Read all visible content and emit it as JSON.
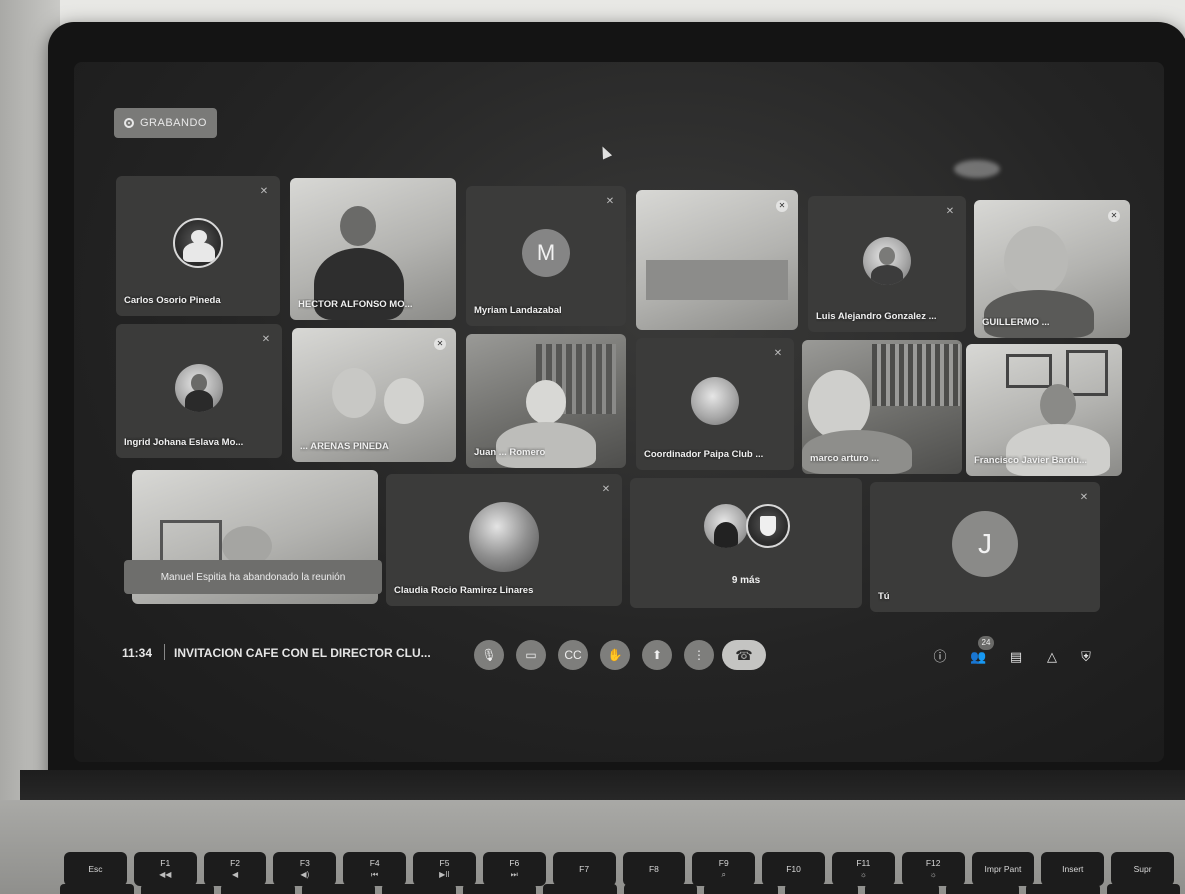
{
  "recording": {
    "label": "GRABANDO"
  },
  "meeting": {
    "time": "11:34",
    "title": "INVITACION CAFE CON EL DIRECTOR CLU...",
    "participant_count": "24"
  },
  "tiles": [
    {
      "name": "Carlos Osorio Pineda"
    },
    {
      "name": "HECTOR ALFONSO MO..."
    },
    {
      "name": "Myriam Landazabal",
      "avatar_letter": "M"
    },
    {
      "name": ""
    },
    {
      "name": "Luis Alejandro Gonzalez ..."
    },
    {
      "name": "GUILLERMO ..."
    },
    {
      "name": "Ingrid Johana Eslava Mo..."
    },
    {
      "name": "... ARENAS PINEDA"
    },
    {
      "name": "Juan ... Romero"
    },
    {
      "name": "Coordinador Paipa Club ..."
    },
    {
      "name": "marco arturo ..."
    },
    {
      "name": "Francisco Javier Bardu..."
    },
    {
      "name": ""
    },
    {
      "name": "Claudia Rocio Ramirez Linares"
    },
    {
      "name": "9 más"
    },
    {
      "name": "Tú",
      "avatar_letter": "J"
    }
  ],
  "notification": "Manuel Espitia ha abandonado la reunión",
  "controls": {
    "icons": [
      "mic-off-icon",
      "camera-off-icon",
      "captions-icon",
      "raise-hand-icon",
      "present-icon",
      "more-options-icon",
      "end-call-icon"
    ],
    "right_icons": [
      "info-icon",
      "people-icon",
      "chat-icon",
      "activities-icon",
      "host-controls-icon"
    ]
  },
  "keyboard": {
    "keys": [
      {
        "label": "Esc",
        "sub": ""
      },
      {
        "label": "F1",
        "sub": "◀◀"
      },
      {
        "label": "F2",
        "sub": "◀"
      },
      {
        "label": "F3",
        "sub": "◀)"
      },
      {
        "label": "F4",
        "sub": "⏮"
      },
      {
        "label": "F5",
        "sub": "▶II"
      },
      {
        "label": "F6",
        "sub": "⏭"
      },
      {
        "label": "F7",
        "sub": ""
      },
      {
        "label": "F8",
        "sub": ""
      },
      {
        "label": "F9",
        "sub": "⌕"
      },
      {
        "label": "F10",
        "sub": ""
      },
      {
        "label": "F11",
        "sub": "☼"
      },
      {
        "label": "F12",
        "sub": "☼"
      },
      {
        "label": "Impr Pant",
        "sub": ""
      },
      {
        "label": "Insert",
        "sub": ""
      },
      {
        "label": "Supr",
        "sub": ""
      }
    ]
  }
}
